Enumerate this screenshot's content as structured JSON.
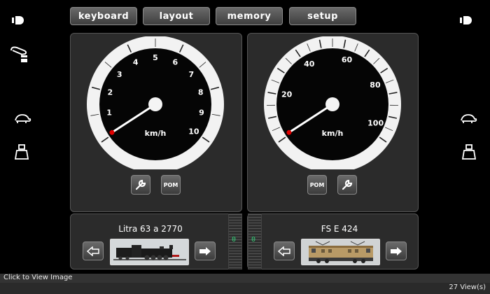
{
  "tabs": {
    "keyboard": "keyboard",
    "layout": "layout",
    "memory": "memory",
    "setup": "setup"
  },
  "gauge_left": {
    "unit": "km/h",
    "ticks": [
      "1",
      "2",
      "3",
      "4",
      "5",
      "6",
      "7",
      "8",
      "9",
      "10"
    ],
    "needle_value": 0
  },
  "gauge_right": {
    "unit": "km/h",
    "ticks": [
      "20",
      "40",
      "60",
      "80",
      "100"
    ],
    "needle_value": 0
  },
  "buttons": {
    "pom_left": "POM",
    "pom_right": "POM"
  },
  "loco_left": {
    "name": "Litra 63 a 2770",
    "speed_readout": "0"
  },
  "loco_right": {
    "name": "FS E 424",
    "speed_readout": "0"
  },
  "footer": {
    "click_hint": "Click to View Image",
    "views": "27 View(s)"
  },
  "colors": {
    "accent": "#e00000",
    "background": "#000000",
    "panel": "#2b2b2b"
  }
}
